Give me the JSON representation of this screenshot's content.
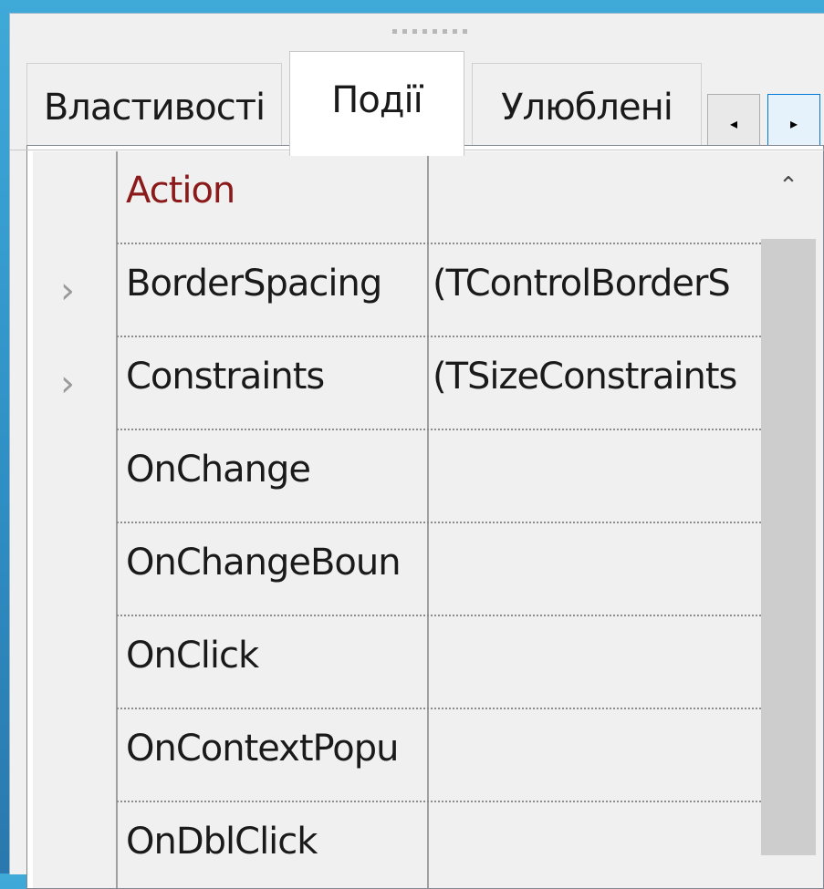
{
  "tabs": [
    {
      "label": "Властивості",
      "active": false
    },
    {
      "label": "Події",
      "active": true
    },
    {
      "label": "Улюблені",
      "active": false
    }
  ],
  "nav": {
    "left_icon": "◂",
    "right_icon": "▸"
  },
  "rows": [
    {
      "name": "Action",
      "value": "",
      "expandable": false,
      "highlight": true
    },
    {
      "name": "BorderSpacing",
      "value": "(TControlBorderS",
      "expandable": true,
      "highlight": false
    },
    {
      "name": "Constraints",
      "value": "(TSizeConstraints",
      "expandable": true,
      "highlight": false
    },
    {
      "name": "OnChange",
      "value": "",
      "expandable": false,
      "highlight": false
    },
    {
      "name": "OnChangeBoun",
      "value": "",
      "expandable": false,
      "highlight": false
    },
    {
      "name": "OnClick",
      "value": "",
      "expandable": false,
      "highlight": false
    },
    {
      "name": "OnContextPopu",
      "value": "",
      "expandable": false,
      "highlight": false
    },
    {
      "name": "OnDblClick",
      "value": "",
      "expandable": false,
      "highlight": false
    }
  ],
  "scroll": {
    "up_icon": "⌃"
  },
  "colors": {
    "highlight": "#8b1a1a",
    "thumb": "#cdcdcd"
  }
}
